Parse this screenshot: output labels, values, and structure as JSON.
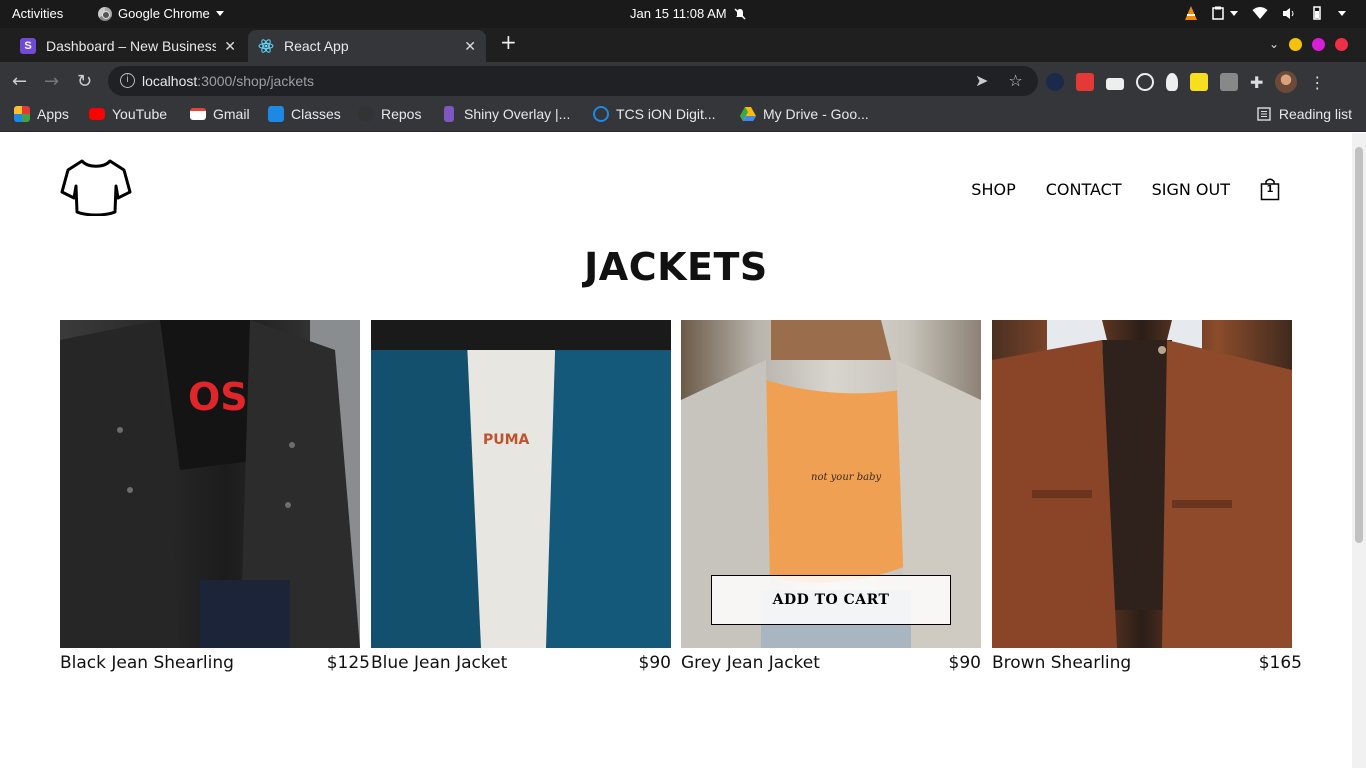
{
  "os_bar": {
    "activities": "Activities",
    "app_name": "Google Chrome",
    "datetime": "Jan 15  11:08 AM"
  },
  "tabs": [
    {
      "title": "Dashboard – New Business",
      "favicon_letter": "S",
      "favicon_color": "#6f4bd8"
    },
    {
      "title": "React App",
      "favicon_color": "#61dafb"
    }
  ],
  "omnibox": {
    "host": "localhost",
    "path": ":3000/shop/jackets"
  },
  "bookmarks": [
    {
      "label": "Apps",
      "icon": "apps-grid-icon",
      "color": "#e74c3c"
    },
    {
      "label": "YouTube",
      "icon": "youtube-icon",
      "color": "#ff0000"
    },
    {
      "label": "Gmail",
      "icon": "gmail-icon",
      "color": "#ea4335"
    },
    {
      "label": "Classes",
      "icon": "classroom-icon",
      "color": "#1e88e5"
    },
    {
      "label": "Repos",
      "icon": "github-icon",
      "color": "#333333"
    },
    {
      "label": "Shiny Overlay |...",
      "icon": "shiny-icon",
      "color": "#7e57c2"
    },
    {
      "label": "TCS iON Digit...",
      "icon": "power-icon",
      "color": "#1e88e5"
    },
    {
      "label": "My Drive - Goo...",
      "icon": "drive-icon",
      "color": "#34a853"
    }
  ],
  "reading_list": "Reading list",
  "site": {
    "nav": {
      "shop": "SHOP",
      "contact": "CONTACT",
      "sign_out": "SIGN OUT",
      "cart_count": "1"
    },
    "heading": "JACKETS",
    "add_to_cart": "ADD TO CART",
    "products": [
      {
        "name": "Black Jean Shearling",
        "price": "$125"
      },
      {
        "name": "Blue Jean Jacket",
        "price": "$90"
      },
      {
        "name": "Grey Jean Jacket",
        "price": "$90"
      },
      {
        "name": "Brown Shearling",
        "price": "$165"
      }
    ]
  },
  "colors": {
    "chrome_dark": "#202124",
    "chrome_mid": "#35363a",
    "page_bg": "#ffffff",
    "text": "#111111"
  }
}
